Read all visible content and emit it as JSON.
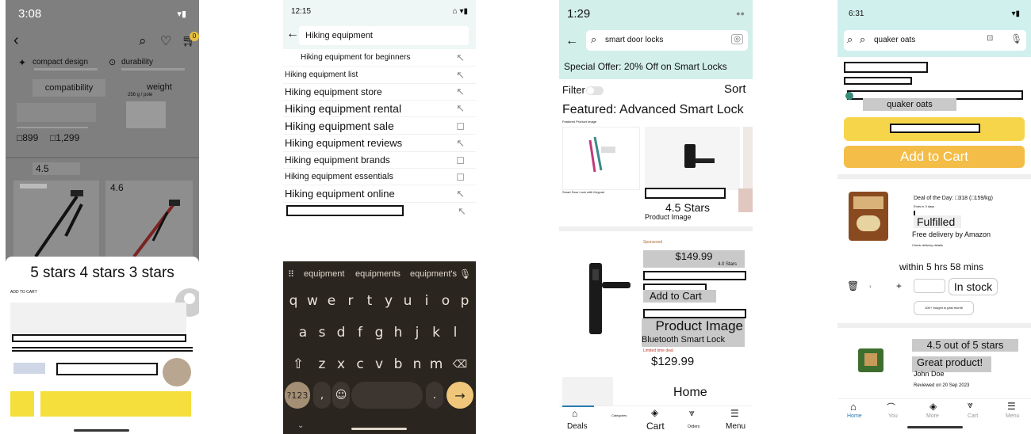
{
  "phone1": {
    "status_time": "3:08",
    "cart_badge": "0",
    "features": [
      "compact design",
      "durability",
      "compatibility",
      "weight"
    ],
    "weight_value": "256 g / pole",
    "price_current": "□899",
    "price_original": "□1,299",
    "rating_a": "4.5",
    "rating_b": "4.6",
    "rating_filter": "5 stars 4 stars 3 stars",
    "add_to_cart_small": "ADD TO CART"
  },
  "phone2": {
    "status_time": "12:15",
    "search_value": "Hiking equipment",
    "suggestions": [
      "Hiking equipment for beginners",
      "Hiking equipment list",
      "Hiking equipment store",
      "Hiking equipment rental",
      "Hiking equipment sale",
      "Hiking equipment reviews",
      "Hiking equipment brands",
      "Hiking equipment essentials",
      "Hiking equipment online"
    ],
    "word_suggestions": [
      "equipment",
      "equipments",
      "equipment's"
    ],
    "keyboard_row1": [
      "q",
      "w",
      "e",
      "r",
      "t",
      "y",
      "u",
      "i",
      "o",
      "p"
    ],
    "keyboard_row1_hints": [
      "1",
      "2",
      "3",
      "4",
      "5",
      "6",
      "7",
      "8",
      "9",
      "0"
    ],
    "keyboard_row2": [
      "a",
      "s",
      "d",
      "f",
      "g",
      "h",
      "j",
      "k",
      "l"
    ],
    "keyboard_row3": [
      "z",
      "x",
      "c",
      "v",
      "b",
      "n",
      "m"
    ],
    "symbols_key": "?123",
    "comma_key": ",",
    "period_key": "."
  },
  "phone3": {
    "status_time": "1:29",
    "search_value": "smart door locks",
    "offer_banner": "Special Offer: 20% Off on Smart Locks",
    "filter_label": "Filter",
    "sort_label": "Sort",
    "featured_heading": "Featured: Advanced Smart Lock",
    "featured_small": "Featured Product Image",
    "card1_caption": "Smart Door Lock with Keypad",
    "card2_rating": "4.5 Stars",
    "card2_caption": "Product Image",
    "sponsored": "Sponsored",
    "price_1": "$149.99",
    "rating_small": "4.0 Stars",
    "add_to_cart": "Add to Cart",
    "product_image_label": "Product Image",
    "product_title": "Bluetooth Smart Lock",
    "limited_deal": "Limited time deal",
    "price_2": "$129.99",
    "home_label": "Home",
    "nav": [
      "Deals",
      "Categories",
      "Cart",
      "Orders",
      "Menu"
    ]
  },
  "phone4": {
    "status_time": "6:31",
    "search_value": "quaker oats",
    "selected_item": "quaker oats",
    "add_to_cart": "Add to Cart",
    "deal_text": "Deal of the Day: □318 (□159/kg)",
    "deal_ends": "Ends in 3 days",
    "fulfilled": "Fulfilled",
    "free_delivery": "Free delivery by Amazon",
    "check_details": "Check delivery details",
    "within": "within 5 hrs 58 mins",
    "qty": "1",
    "in_stock": "In stock",
    "bought": "10K+ bought in past month",
    "rating": "4.5 out of 5 stars",
    "review_title": "Great product!",
    "reviewer": "John Doe",
    "review_date": "Reviewed on 20 Sep 2023",
    "nav": [
      "Home",
      "You",
      "More",
      "Cart",
      "Menu"
    ]
  },
  "colors": {
    "amazon_yellow": "#f7d54a",
    "amazon_orange": "#f3bd47",
    "teal_header": "#cfeeea",
    "link_blue": "#2a7ab0",
    "keyboard_bg": "#2b2520",
    "keyboard_accent": "#f0c77a"
  }
}
